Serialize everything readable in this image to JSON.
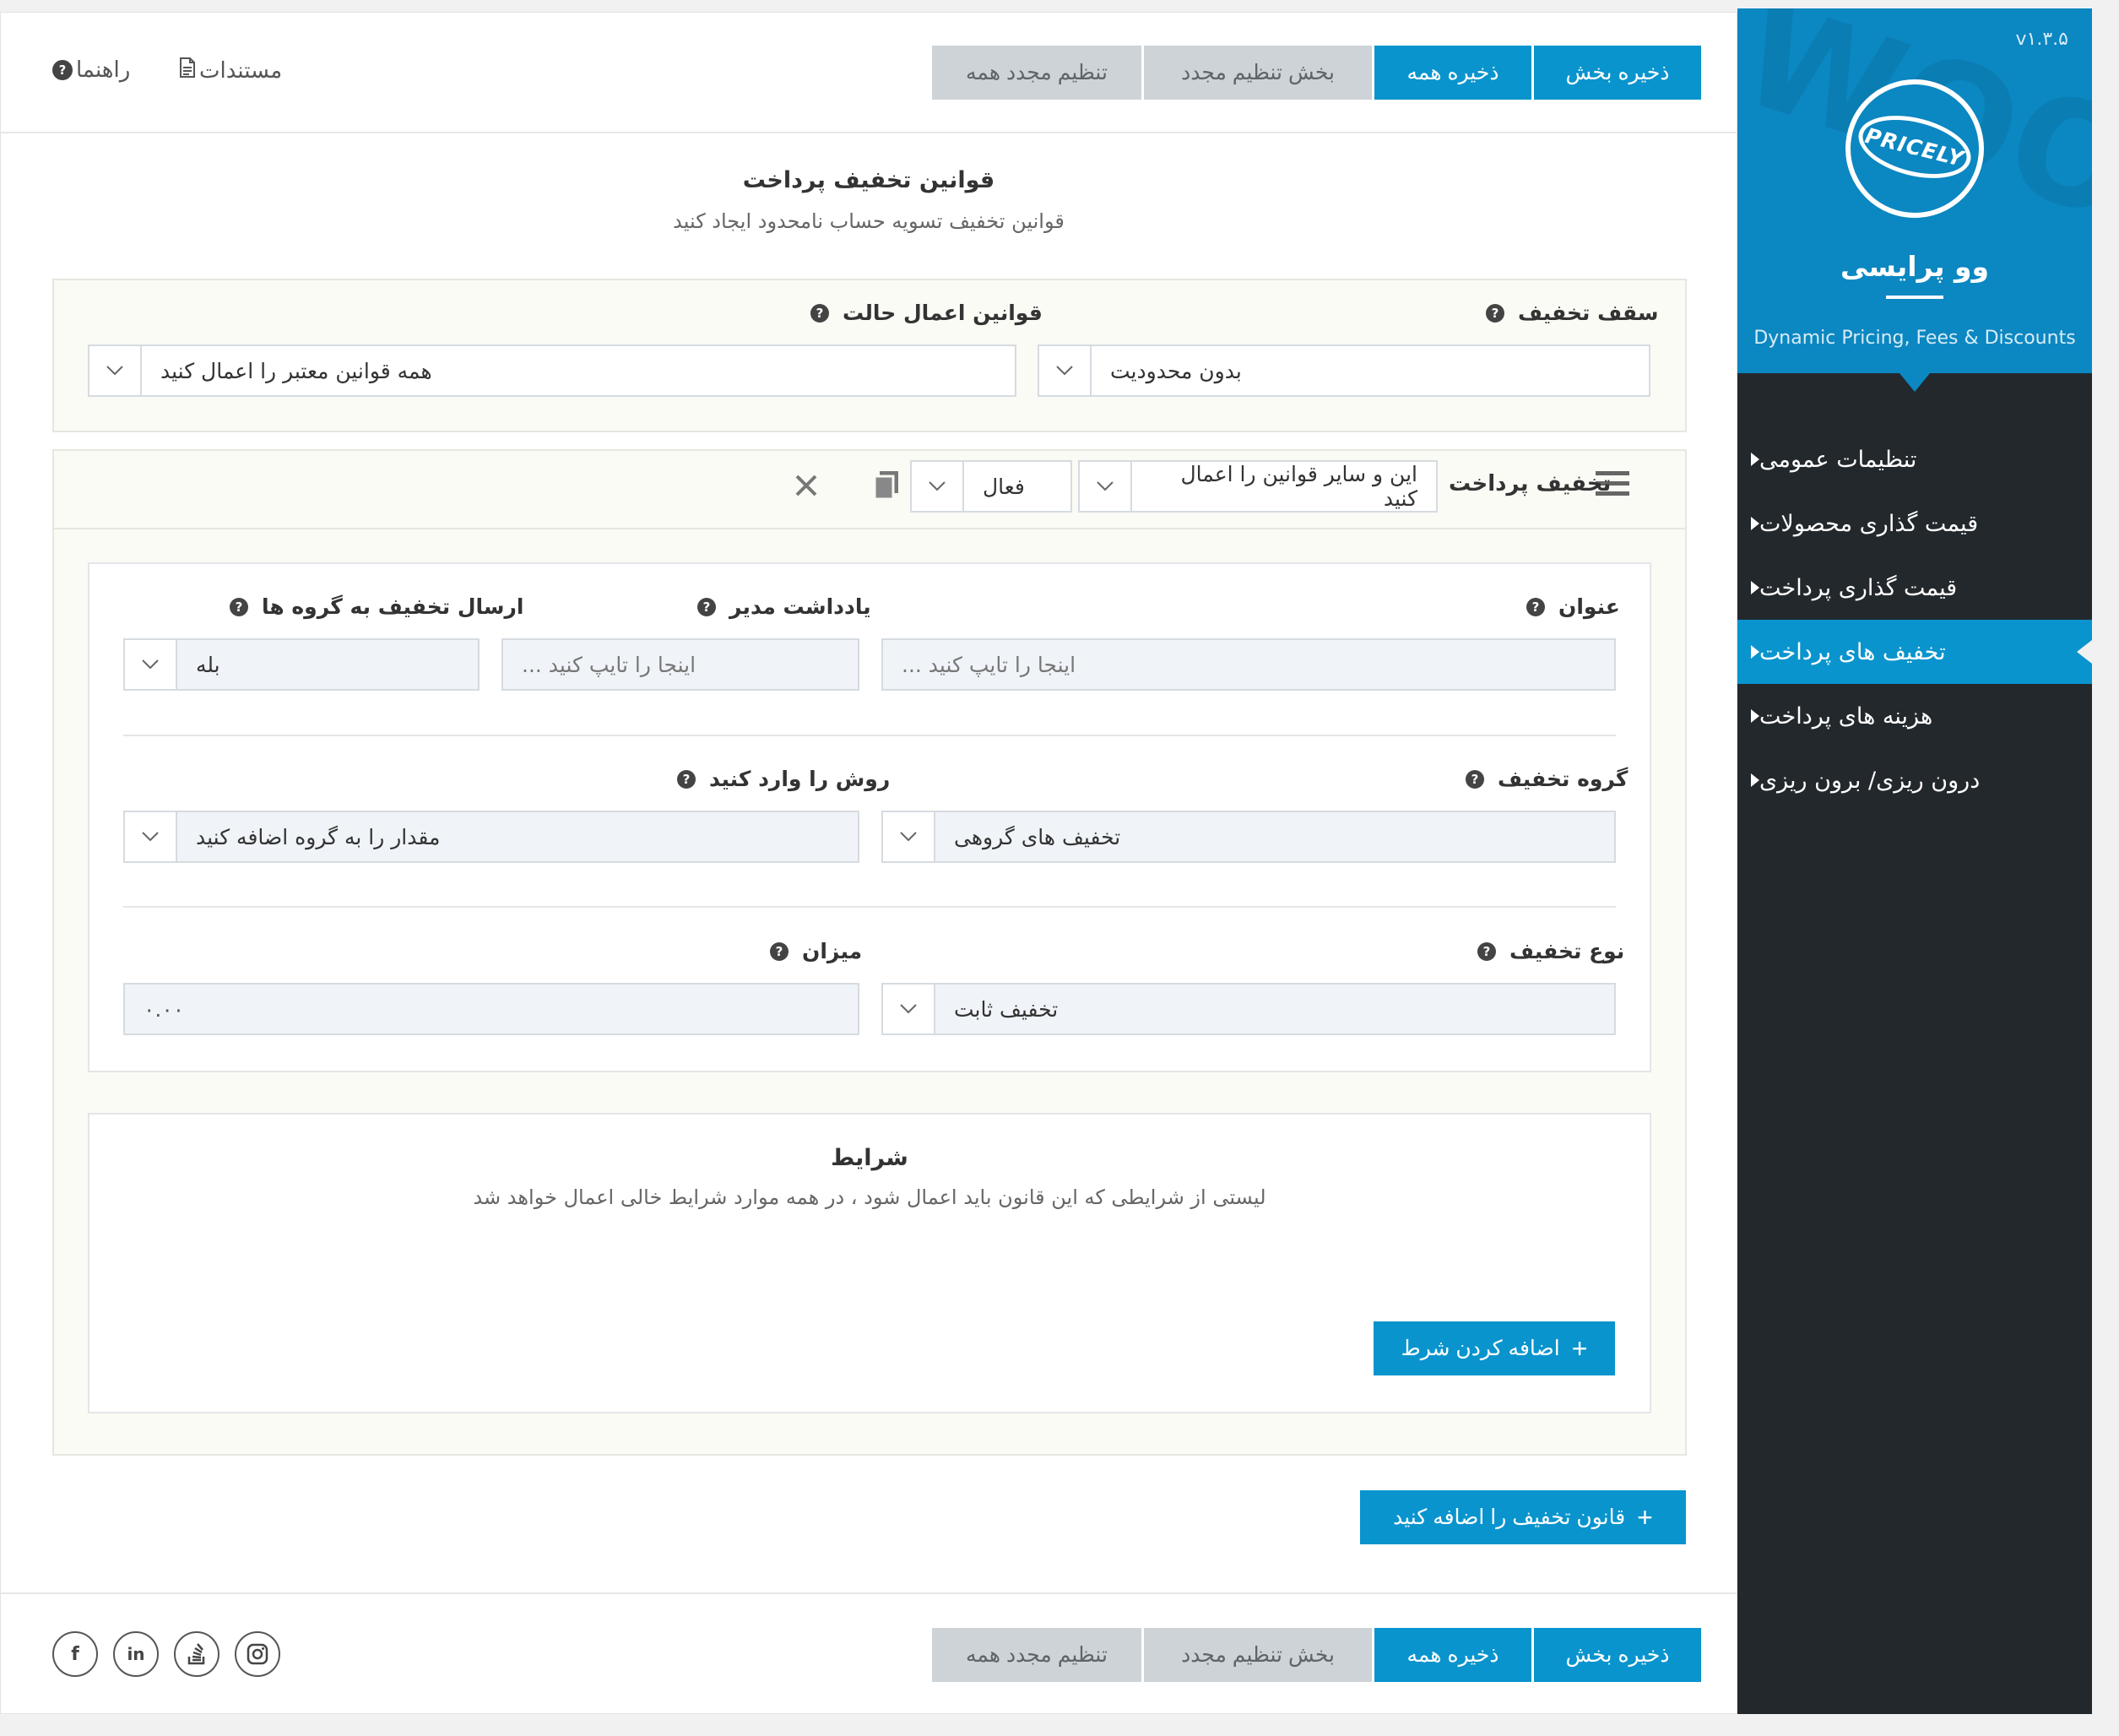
{
  "toolbar": {
    "save_section": "ذخیره بخش",
    "save_all": "ذخیره همه",
    "reset_section": "بخش تنظیم مجدد",
    "reset_all": "تنظیم مجدد همه",
    "docs": "مستندات",
    "help": "راهنما"
  },
  "section": {
    "title": "قوانین تخفیف پرداخت",
    "subtitle": "قوانین تخفیف تسویه حساب نامحدود ایجاد کنید"
  },
  "settings": {
    "cap_label": "سقف تخفیف",
    "cap_value": "بدون محدودیت",
    "mode_label": "قوانین اعمال حالت",
    "mode_value": "همه قوانین معتبر را اعمال کنید"
  },
  "rule": {
    "header_title": "تخفیف پرداخت",
    "apply_mode": "این و سایر قوانین را اعمال کنید",
    "status": "فعال",
    "fields": {
      "title_label": "عنوان",
      "title_placeholder": "اینجا را تایپ کنید ...",
      "note_label": "یادداشت مدیر",
      "note_placeholder": "اینجا را تایپ کنید ...",
      "send_label": "ارسال تخفیف به گروه ها",
      "send_value": "بله",
      "group_label": "گروه تخفیف",
      "group_value": "تخفیف های گروهی",
      "method_label": "روش را وارد کنید",
      "method_value": "مقدار را به گروه اضافه کنید",
      "type_label": "نوع تخفیف",
      "type_value": "تخفیف ثابت",
      "amount_label": "میزان",
      "amount_value": "۰.۰۰"
    },
    "conditions": {
      "title": "شرایط",
      "subtitle": "لیستی از شرایطی که این قانون باید اعمال شود ، در همه موارد شرایط خالی اعمال خواهد شد",
      "add_button": "اضافه کردن شرط"
    }
  },
  "add_rule_button": "قانون تخفیف را اضافه کنید",
  "sidebar": {
    "version": "v۱.۳.۵",
    "logo_text": "PRICELY",
    "brand": "وو پرایسی",
    "tagline": "Dynamic Pricing, Fees & Discounts",
    "items": [
      {
        "label": "تنظیمات عمومی"
      },
      {
        "label": "قیمت گذاری محصولات"
      },
      {
        "label": "قیمت گذاری پرداخت"
      },
      {
        "label": "تخفیف های پرداخت"
      },
      {
        "label": "هزینه های پرداخت"
      },
      {
        "label": "درون ریزی/ برون ریزی"
      }
    ],
    "active_index": 3
  },
  "social": {
    "facebook": "f",
    "linkedin": "in"
  },
  "colors": {
    "accent": "#0994ce",
    "sidebar_bg": "#23282d",
    "button_gray": "#cdd3d7"
  }
}
